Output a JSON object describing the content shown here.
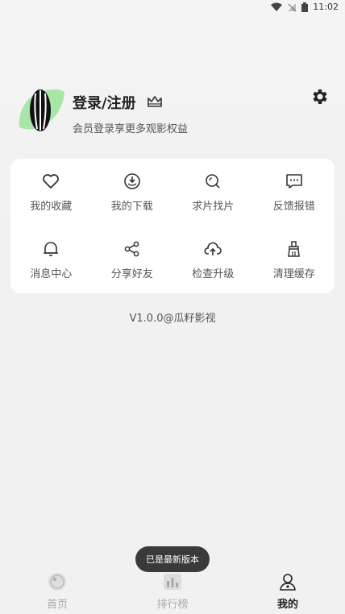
{
  "status": {
    "time": "11:02"
  },
  "profile": {
    "login_label": "登录/注册",
    "subtitle": "会员登录享更多观影权益"
  },
  "grid": {
    "items": [
      {
        "label": "我的收藏",
        "icon": "heart-icon"
      },
      {
        "label": "我的下载",
        "icon": "download-icon"
      },
      {
        "label": "求片找片",
        "icon": "search-icon"
      },
      {
        "label": "反馈报错",
        "icon": "feedback-icon"
      },
      {
        "label": "消息中心",
        "icon": "bell-icon"
      },
      {
        "label": "分享好友",
        "icon": "share-icon"
      },
      {
        "label": "检查升级",
        "icon": "cloud-upload-icon"
      },
      {
        "label": "清理缓存",
        "icon": "broom-icon"
      }
    ]
  },
  "version": "V1.0.0@瓜籽影视",
  "toast": "已是最新版本",
  "tabs": [
    {
      "label": "首页",
      "icon": "home-icon"
    },
    {
      "label": "排行榜",
      "icon": "ranking-icon"
    },
    {
      "label": "我的",
      "icon": "profile-icon"
    }
  ],
  "colors": {
    "accent_leaf": "#a8e6a8",
    "card_bg": "#ffffff",
    "toast_bg": "#3a3a3a"
  }
}
